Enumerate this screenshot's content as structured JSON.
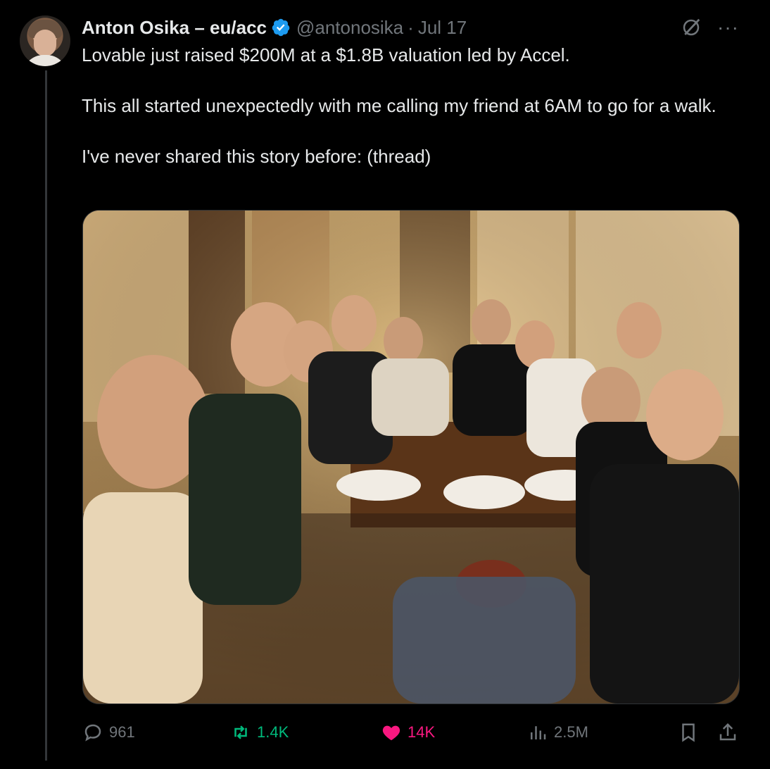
{
  "author": {
    "name": "Anton Osika – eu/acc",
    "handle": "@antonosika",
    "separator": "·",
    "date": "Jul 17"
  },
  "icons": {
    "verified": "verified-badge-icon",
    "grok": "grok-icon",
    "more": "more-icon",
    "reply": "reply-icon",
    "retweet": "retweet-icon",
    "like": "heart-icon",
    "views": "views-icon",
    "bookmark": "bookmark-icon",
    "share": "share-icon"
  },
  "tweet": {
    "paragraphs": [
      "Lovable just raised $200M at a $1.8B valuation led by Accel.",
      "This all started unexpectedly with me calling my friend at 6AM to go for a walk.",
      "I've never shared this story before: (thread)"
    ]
  },
  "metrics": {
    "replies": "961",
    "retweets": "1.4K",
    "likes": "14K",
    "views": "2.5M"
  },
  "colors": {
    "background": "#000000",
    "text": "#e7e9ea",
    "muted": "#71767b",
    "verified": "#1d9bf0",
    "retweet": "#00ba7c",
    "like": "#f91880"
  }
}
